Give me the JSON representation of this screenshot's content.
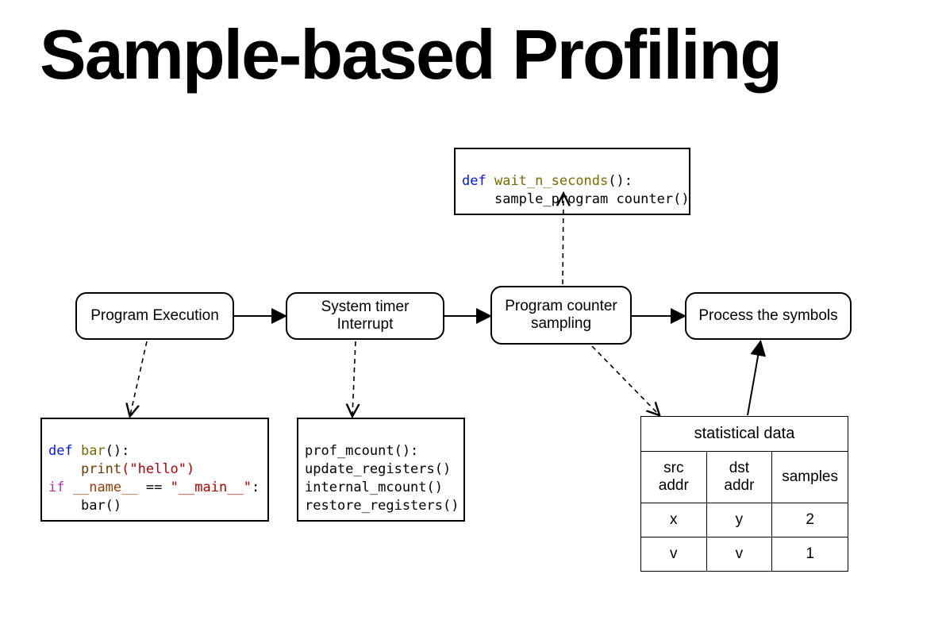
{
  "title": "Sample-based Profiling",
  "nodes": {
    "program_execution": "Program Execution",
    "system_timer": "System timer Interrupt",
    "pc_sampling": "Program counter\nsampling",
    "process_symbols": "Process the symbols"
  },
  "code_top": {
    "def": "def",
    "fn_name": "wait_n_seconds",
    "call_indent": "    ",
    "call": "sample_program counter()"
  },
  "code_bar": {
    "def": "def",
    "fn_name": "bar",
    "print_line_indent": "    ",
    "print_builtin": "print",
    "print_arg": "(\"hello\")",
    "if_kw": "if",
    "name_dunder": "__name__",
    "eq": " == ",
    "main_str": "\"__main__\"",
    "colon": ":",
    "bar_call_indent": "    ",
    "bar_call": "bar()"
  },
  "code_prof": {
    "l1": "prof_mcount():",
    "l2": "update_registers()",
    "l3": "internal_mcount()",
    "l4": "restore_registers()"
  },
  "table": {
    "title": "statistical data",
    "headers": [
      "src addr",
      "dst addr",
      "samples"
    ],
    "rows": [
      [
        "x",
        "y",
        "2"
      ],
      [
        "v",
        "v",
        "1"
      ]
    ]
  }
}
